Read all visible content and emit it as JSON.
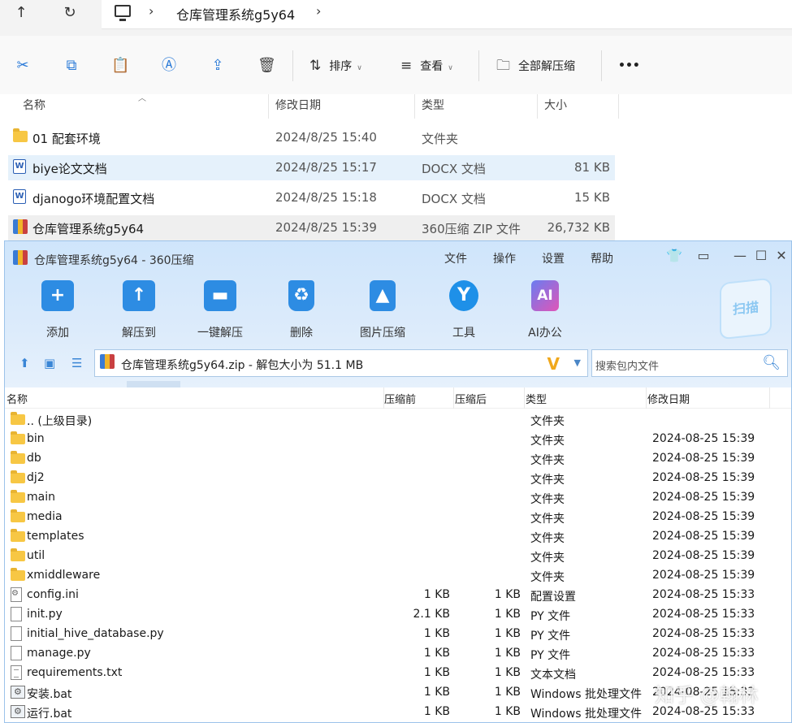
{
  "explorer": {
    "breadcrumb": "仓库管理系统g5y64",
    "toolbar": {
      "sort_label": "排序",
      "view_label": "查看",
      "extract_all_label": "全部解压缩",
      "more_label": "•••"
    },
    "columns": {
      "name": "名称",
      "modified": "修改日期",
      "type": "类型",
      "size": "大小"
    },
    "rows": [
      {
        "name": "01 配套环境",
        "modified": "2024/8/25 15:40",
        "type": "文件夹",
        "size": ""
      },
      {
        "name": "biye论文文档",
        "modified": "2024/8/25 15:17",
        "type": "DOCX 文档",
        "size": "81 KB"
      },
      {
        "name": "djanogo环境配置文档",
        "modified": "2024/8/25 15:18",
        "type": "DOCX 文档",
        "size": "15 KB"
      },
      {
        "name": "仓库管理系统g5y64",
        "modified": "2024/8/25 15:39",
        "type": "360压缩 ZIP 文件",
        "size": "26,732 KB"
      }
    ]
  },
  "zipwin": {
    "title": "仓库管理系统g5y64 - 360压缩",
    "menu": [
      "文件",
      "操作",
      "设置",
      "帮助"
    ],
    "tools": [
      "添加",
      "解压到",
      "一键解压",
      "删除",
      "图片压缩",
      "工具",
      "AI办公"
    ],
    "scan_label": "扫描",
    "path": "仓库管理系统g5y64.zip - 解包大小为 51.1 MB",
    "search_placeholder": "搜索包内文件",
    "columns": {
      "name": "名称",
      "before": "压缩前",
      "after": "压缩后",
      "type": "类型",
      "modified": "修改日期"
    },
    "rows": [
      {
        "name": ".. (上级目录)",
        "before": "",
        "after": "",
        "type": "文件夹",
        "modified": "",
        "kind": "folder"
      },
      {
        "name": "bin",
        "before": "",
        "after": "",
        "type": "文件夹",
        "modified": "2024-08-25 15:39",
        "kind": "folder"
      },
      {
        "name": "db",
        "before": "",
        "after": "",
        "type": "文件夹",
        "modified": "2024-08-25 15:39",
        "kind": "folder"
      },
      {
        "name": "dj2",
        "before": "",
        "after": "",
        "type": "文件夹",
        "modified": "2024-08-25 15:39",
        "kind": "folder"
      },
      {
        "name": "main",
        "before": "",
        "after": "",
        "type": "文件夹",
        "modified": "2024-08-25 15:39",
        "kind": "folder"
      },
      {
        "name": "media",
        "before": "",
        "after": "",
        "type": "文件夹",
        "modified": "2024-08-25 15:39",
        "kind": "folder"
      },
      {
        "name": "templates",
        "before": "",
        "after": "",
        "type": "文件夹",
        "modified": "2024-08-25 15:39",
        "kind": "folder"
      },
      {
        "name": "util",
        "before": "",
        "after": "",
        "type": "文件夹",
        "modified": "2024-08-25 15:39",
        "kind": "folder"
      },
      {
        "name": "xmiddleware",
        "before": "",
        "after": "",
        "type": "文件夹",
        "modified": "2024-08-25 15:39",
        "kind": "folder"
      },
      {
        "name": "config.ini",
        "before": "1 KB",
        "after": "1 KB",
        "type": "配置设置",
        "modified": "2024-08-25 15:33",
        "kind": "ini"
      },
      {
        "name": "init.py",
        "before": "2.1 KB",
        "after": "1 KB",
        "type": "PY 文件",
        "modified": "2024-08-25 15:33",
        "kind": "file"
      },
      {
        "name": "initial_hive_database.py",
        "before": "1 KB",
        "after": "1 KB",
        "type": "PY 文件",
        "modified": "2024-08-25 15:33",
        "kind": "file"
      },
      {
        "name": "manage.py",
        "before": "1 KB",
        "after": "1 KB",
        "type": "PY 文件",
        "modified": "2024-08-25 15:33",
        "kind": "file"
      },
      {
        "name": "requirements.txt",
        "before": "1 KB",
        "after": "1 KB",
        "type": "文本文档",
        "modified": "2024-08-25 15:33",
        "kind": "text"
      },
      {
        "name": "安装.bat",
        "before": "1 KB",
        "after": "1 KB",
        "type": "Windows 批处理文件",
        "modified": "2024-08-25 15:33",
        "kind": "bat"
      },
      {
        "name": "运行.bat",
        "before": "1 KB",
        "after": "1 KB",
        "type": "Windows 批处理文件",
        "modified": "2024-08-25 15:33",
        "kind": "bat"
      }
    ]
  },
  "watermark": "知乎 @翰林",
  "colors": {
    "accent": "#2d8ce3",
    "selection": "#e5f1fb",
    "folder": "#f7c744"
  }
}
